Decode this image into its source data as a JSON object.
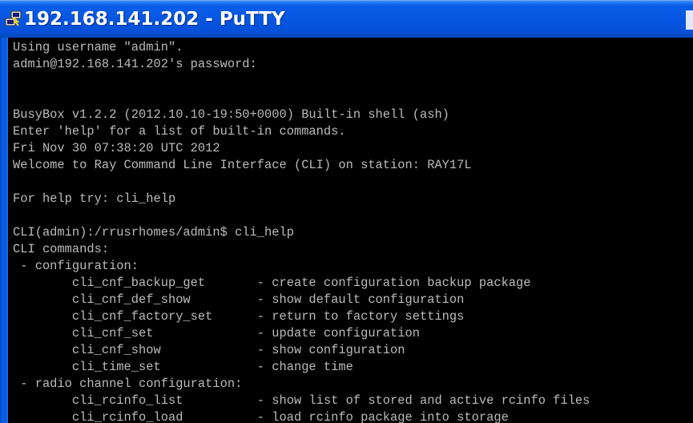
{
  "window": {
    "title": "192.168.141.202 - PuTTY",
    "icon": "putty-icon"
  },
  "terminal": {
    "background": "#000000",
    "foreground": "#bbbbbb",
    "lines": [
      "Using username \"admin\".",
      "admin@192.168.141.202's password:",
      "",
      "",
      "BusyBox v1.2.2 (2012.10.10-19:50+0000) Built-in shell (ash)",
      "Enter 'help' for a list of built-in commands.",
      "Fri Nov 30 07:38:20 UTC 2012",
      "Welcome to Ray Command Line Interface (CLI) on station: RAY17L",
      "",
      "For help try: cli_help",
      "",
      "CLI(admin):/rrusrhomes/admin$ cli_help",
      "CLI commands:",
      " - configuration:",
      "        cli_cnf_backup_get       - create configuration backup package",
      "        cli_cnf_def_show         - show default configuration",
      "        cli_cnf_factory_set      - return to factory settings",
      "        cli_cnf_set              - update configuration",
      "        cli_cnf_show             - show configuration",
      "        cli_time_set             - change time",
      " - radio channel configuration:",
      "        cli_rcinfo_list          - show list of stored and active rcinfo files",
      "        cli_rcinfo_load          - load rcinfo package into storage"
    ]
  }
}
